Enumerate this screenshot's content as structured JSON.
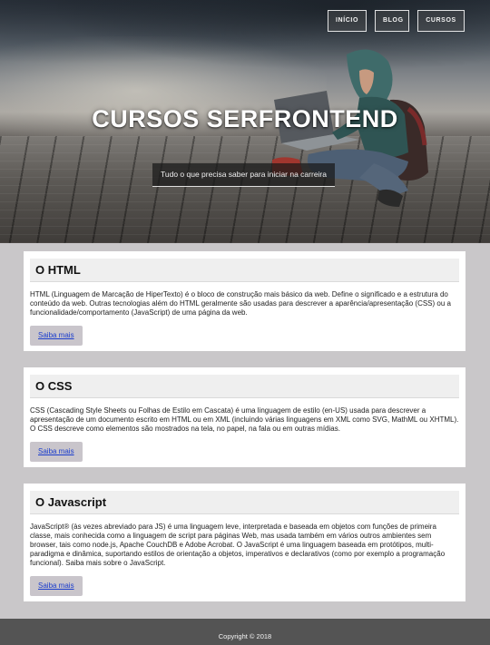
{
  "nav": {
    "items": [
      {
        "label": "INÍCIO"
      },
      {
        "label": "BLOG"
      },
      {
        "label": "CURSOS"
      }
    ]
  },
  "hero": {
    "title": "CURSOS SERFRONTEND",
    "subtitle": "Tudo o que precisa saber para iniciar na carreira"
  },
  "cards": [
    {
      "title": "O HTML",
      "text": "HTML (Linguagem de Marcação de HiperTexto) é o bloco de construção mais básico da web. Define o significado e a estrutura do conteúdo da web. Outras tecnologias além do HTML geralmente são usadas para descrever a aparência/apresentação (CSS) ou a funcionalidade/comportamento (JavaScript) de uma página da web.",
      "link": "Saiba mais"
    },
    {
      "title": "O CSS",
      "text": "CSS (Cascading Style Sheets ou Folhas de Estilo em Cascata) é uma linguagem de estilo (en-US) usada para descrever a apresentação de um documento escrito em HTML ou em XML (incluindo várias linguagens em XML como SVG, MathML ou XHTML). O CSS descreve como elementos são mostrados na tela, no papel, na fala ou em outras mídias.",
      "link": "Saiba mais"
    },
    {
      "title": "O Javascript",
      "text": "JavaScript® (às vezes abreviado para JS) é uma linguagem leve, interpretada e baseada em objetos com funções de primeira classe, mais conhecida como a linguagem de script para páginas Web, mas usada também em vários outros ambientes sem browser, tais como node.js, Apache CouchDB e Adobe Acrobat. O JavaScript é uma linguagem baseada em protótipos, multi-paradigma e dinâmica, suportando estilos de orientação a objetos, imperativos e declarativos (como por exemplo a programação funcional). Saiba mais sobre o JavaScript.",
      "link": "Saiba mais"
    }
  ],
  "footer": {
    "text": "Copyright © 2018"
  },
  "colors": {
    "page_bg": "#c9c7c9",
    "footer_bg": "#545454",
    "link": "#1a3ccc",
    "button_bg": "#c9c5cb"
  }
}
